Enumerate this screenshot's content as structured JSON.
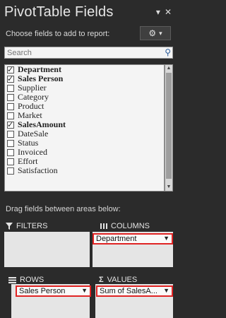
{
  "header": {
    "title": "PivotTable Fields",
    "dropdown_icon": "chevron-down-icon",
    "close_icon": "close-icon"
  },
  "choose": {
    "label": "Choose fields to add to report:",
    "tools_icon": "gear-icon"
  },
  "search": {
    "placeholder": "Search",
    "icon": "search-icon"
  },
  "fields": [
    {
      "label": "Department",
      "checked": true
    },
    {
      "label": "Sales Person",
      "checked": true
    },
    {
      "label": "Supplier",
      "checked": false
    },
    {
      "label": "Category",
      "checked": false
    },
    {
      "label": "Product",
      "checked": false
    },
    {
      "label": "Market",
      "checked": false
    },
    {
      "label": "SalesAmount",
      "checked": true
    },
    {
      "label": "DateSale",
      "checked": false
    },
    {
      "label": "Status",
      "checked": false
    },
    {
      "label": "Invoiced",
      "checked": false
    },
    {
      "label": "Effort",
      "checked": false
    },
    {
      "label": "Satisfaction",
      "checked": false
    }
  ],
  "drag_label": "Drag fields between areas below:",
  "areas": {
    "filters": {
      "label": "FILTERS",
      "icon": "filter-icon"
    },
    "columns": {
      "label": "COLUMNS",
      "icon": "columns-icon",
      "item": "Department"
    },
    "rows": {
      "label": "ROWS",
      "icon": "rows-icon",
      "item": "Sales Person"
    },
    "values": {
      "label": "VALUES",
      "icon": "sigma-icon",
      "item": "Sum of SalesA..."
    }
  },
  "colors": {
    "pane_bg": "#2b2b2b",
    "highlight": "#e02424",
    "area_bg": "#e5e5e5"
  }
}
